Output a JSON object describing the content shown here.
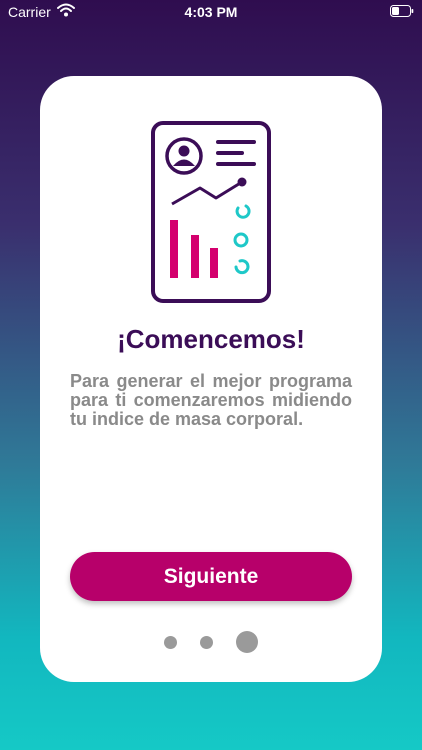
{
  "status_bar": {
    "carrier": "Carrier",
    "time": "4:03 PM",
    "icons": [
      "wifi-icon",
      "battery-icon"
    ]
  },
  "onboarding": {
    "title": "¡Comencemos!",
    "description": "Para generar el mejor programa para ti comenzaremos midiendo tu indice de masa corporal.",
    "next_label": "Siguiente",
    "pages_total": 3,
    "current_page": 3,
    "illustration": "report-document-icon"
  },
  "colors": {
    "title": "#3b0d57",
    "button": "#b7006a",
    "illustration_outline": "#3b0d57",
    "illustration_bars": "#d4006e",
    "illustration_rings": "#1ec8c8",
    "description": "#8a8a8a"
  }
}
